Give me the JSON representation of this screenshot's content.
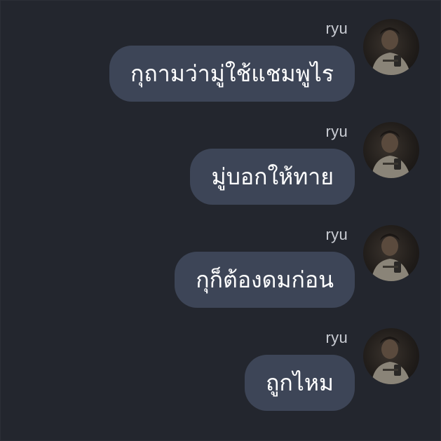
{
  "messages": [
    {
      "sender": "ryu",
      "text": "กุถามว่ามู่ใช้แชมพูไร",
      "avatar_icon": "user-avatar-photo"
    },
    {
      "sender": "ryu",
      "text": "มู่บอกให้ทาย",
      "avatar_icon": "user-avatar-photo"
    },
    {
      "sender": "ryu",
      "text": "กุก็ต้องดมก่อน",
      "avatar_icon": "user-avatar-photo"
    },
    {
      "sender": "ryu",
      "text": "ถูกไหม",
      "avatar_icon": "user-avatar-photo"
    }
  ],
  "colors": {
    "background": "#23262e",
    "bubble": "#3d4557",
    "bubble_text": "#ffffff",
    "sender_text": "#c9ccd3"
  }
}
